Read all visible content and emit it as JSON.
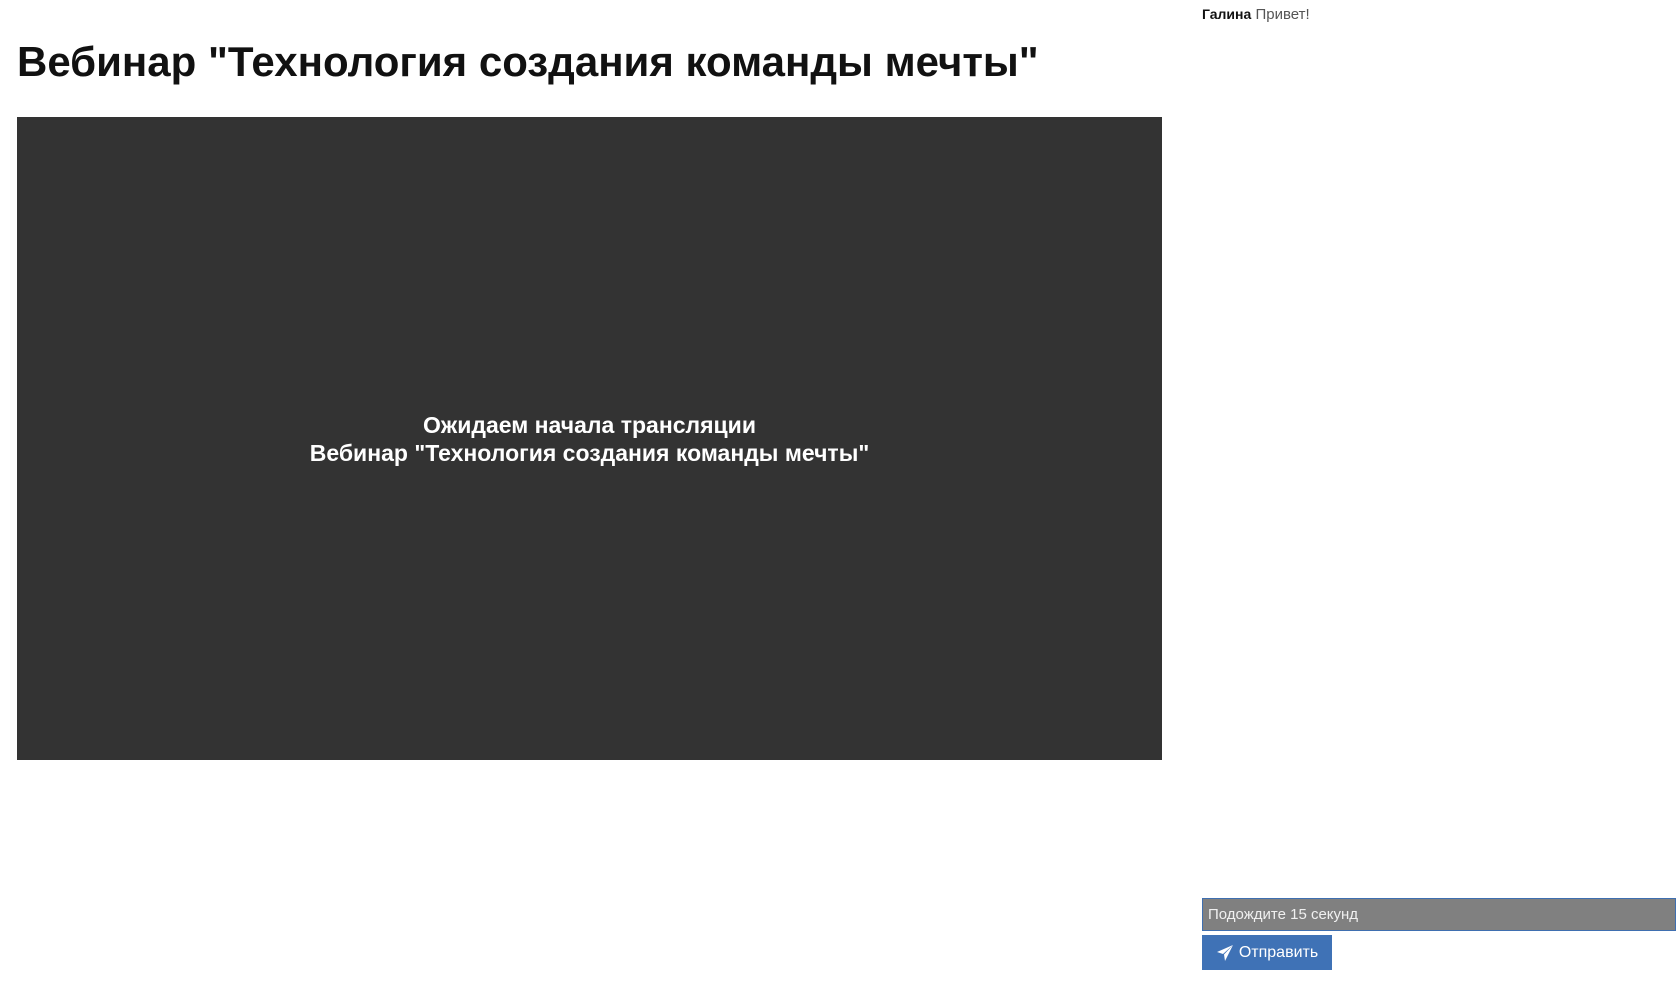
{
  "page": {
    "title": "Вебинар \"Технология создания команды мечты\""
  },
  "player": {
    "status_line1": "Ожидаем начала трансляции",
    "status_line2": "Вебинар \"Технология создания команды мечты\"",
    "background_color": "#333333"
  },
  "chat": {
    "messages": [
      {
        "author": "Галина",
        "text": "Привет!"
      }
    ],
    "input": {
      "value": "",
      "placeholder": "Подождите 15 секунд"
    },
    "send_button": {
      "label": "Отправить",
      "icon": "paper-plane-icon",
      "color": "#3f72b6"
    }
  }
}
